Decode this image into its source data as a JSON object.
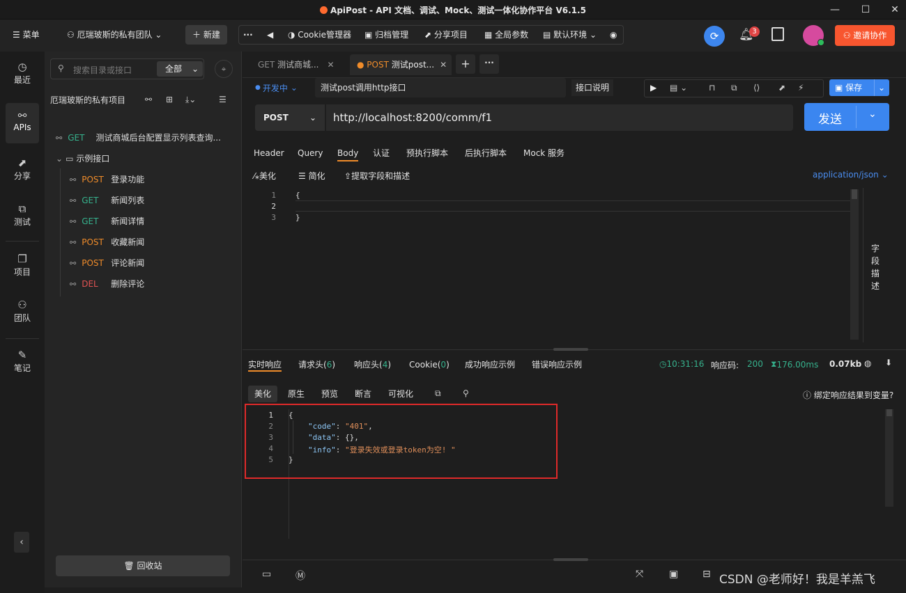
{
  "app": {
    "title": "ApiPost - API 文档、调试、Mock、测试一体化协作平台 V6.1.5"
  },
  "window_controls": [
    "minimize-icon",
    "maximize-icon",
    "close-icon"
  ],
  "topbar": {
    "menu_label": "菜单",
    "team_label": "厄瑞玻斯的私有团队",
    "new_label": "新建",
    "tools": {
      "more": "···",
      "cookie": "Cookie管理器",
      "archive": "归档管理",
      "share": "分享项目",
      "global_params": "全局参数",
      "env": "默认环境"
    },
    "notification_count": "3",
    "invite_label": "邀请协作"
  },
  "leftnav": {
    "items": [
      {
        "label": "最近",
        "icon": "clock-icon"
      },
      {
        "label": "APIs",
        "icon": "link-icon"
      },
      {
        "label": "分享",
        "icon": "share-icon"
      },
      {
        "label": "测试",
        "icon": "test-icon"
      },
      {
        "label": "项目",
        "icon": "project-icon"
      },
      {
        "label": "团队",
        "icon": "team-icon"
      },
      {
        "label": "笔记",
        "icon": "note-icon"
      }
    ]
  },
  "sidebar": {
    "search_placeholder": "搜索目录或接口",
    "scope": "全部",
    "project_name": "厄瑞玻斯的私有项目",
    "tree": {
      "root_api": {
        "method": "GET",
        "name": "测试商城后台配置显示列表查询..."
      },
      "folder": "示例接口",
      "children": [
        {
          "method": "POST",
          "name": "登录功能"
        },
        {
          "method": "GET",
          "name": "新闻列表"
        },
        {
          "method": "GET",
          "name": "新闻详情"
        },
        {
          "method": "POST",
          "name": "收藏新闻"
        },
        {
          "method": "POST",
          "name": "评论新闻"
        },
        {
          "method": "DEL",
          "name": "删除评论"
        }
      ]
    },
    "recycle_label": "回收站"
  },
  "tabs": [
    {
      "method": "GET",
      "name": "测试商城..."
    },
    {
      "method": "POST",
      "name": "测试post..."
    }
  ],
  "request": {
    "status": "开发中",
    "name": "测试post调用http接口",
    "doc_label": "接口说明",
    "save_label": "保存",
    "method": "POST",
    "url": "http://localhost:8200/comm/f1",
    "send_label": "发送"
  },
  "request_tabs": [
    "Header",
    "Query",
    "Body",
    "认证",
    "预执行脚本",
    "后执行脚本",
    "Mock 服务"
  ],
  "body_toolbar": {
    "beautify": "美化",
    "simplify": "简化",
    "extract": "提取字段和描述",
    "content_type": "application/json"
  },
  "body_editor": {
    "line_numbers": [
      "1",
      "2",
      "3"
    ],
    "lines": [
      "{",
      "",
      "}"
    ]
  },
  "field_desc_label": "字段描述",
  "response": {
    "tabs": [
      "实时响应",
      "请求头",
      "响应头",
      "Cookie",
      "成功响应示例",
      "错误响应示例"
    ],
    "tab_counts": {
      "req_headers": "6",
      "res_headers": "4",
      "cookie": "0"
    },
    "time": "10:31:16",
    "code_label": "响应码:",
    "code": "200",
    "duration": "176.00ms",
    "size": "0.07kb",
    "views": [
      "美化",
      "原生",
      "预览",
      "断言",
      "可视化"
    ],
    "bind_label": "绑定响应结果到变量?",
    "line_numbers": [
      "1",
      "2",
      "3",
      "4",
      "5"
    ],
    "json": {
      "open": "{",
      "code_key": "\"code\"",
      "code_val": "\"401\"",
      "data_key": "\"data\"",
      "data_val": "{}",
      "info_key": "\"info\"",
      "info_val": "\"登录失效或登录token为空! \"",
      "close": "}"
    }
  },
  "watermark": "CSDN @老师好！我是羊羔飞",
  "colors": {
    "accent": "#3b86f0",
    "invite": "#f8562f",
    "get": "#36b28d",
    "post": "#f08c2a",
    "delete": "#e35353",
    "highlight_box": "#e02a2a"
  }
}
